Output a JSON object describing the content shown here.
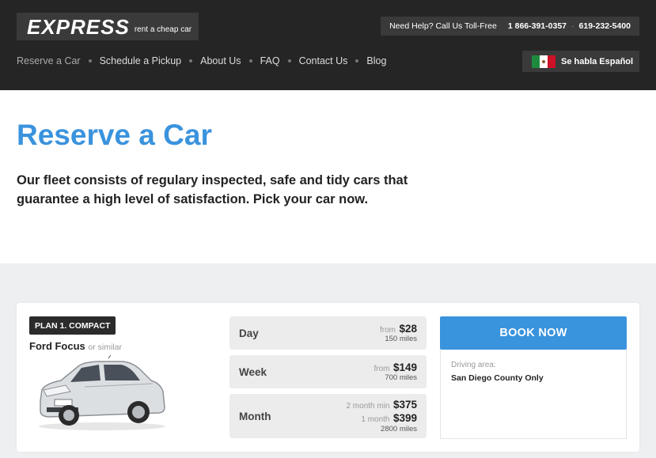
{
  "header": {
    "logo_word": "EXPRESS",
    "logo_tagline": "rent a cheap car",
    "help_label": "Need Help? Call Us Toll-Free",
    "phone_1": "1 866-391-0357",
    "phone_sep": "·",
    "phone_2": "619-232-5400",
    "nav": [
      "Reserve a Car",
      "Schedule a Pickup",
      "About Us",
      "FAQ",
      "Contact Us",
      "Blog"
    ],
    "lang_button": "Se habla Español",
    "colors": {
      "bar_bg": "#252525",
      "box_bg": "#3a3a3a"
    }
  },
  "intro": {
    "title": "Reserve a Car",
    "description": "Our fleet consists of regulary inspected, safe and tidy cars that guarantee a high level of satisfaction. Pick your car now."
  },
  "plan": {
    "badge": "PLAN 1. COMPACT",
    "car_name": "Ford Focus",
    "car_similar": "or similar",
    "prices": [
      {
        "period": "Day",
        "lines": [
          {
            "from": "from",
            "amount": "$28"
          }
        ],
        "miles": "150 miles"
      },
      {
        "period": "Week",
        "lines": [
          {
            "from": "from",
            "amount": "$149"
          }
        ],
        "miles": "700 miles"
      },
      {
        "period": "Month",
        "lines": [
          {
            "from": "2 month min",
            "amount": "$375"
          },
          {
            "from": "1 month",
            "amount": "$399"
          }
        ],
        "miles": "2800 miles"
      }
    ],
    "book_button": "BOOK NOW",
    "driving_area_label": "Driving area:",
    "driving_area_value": "San Diego County Only"
  },
  "colors": {
    "accent": "#3a93dd",
    "page_bg": "#eeeff1"
  }
}
